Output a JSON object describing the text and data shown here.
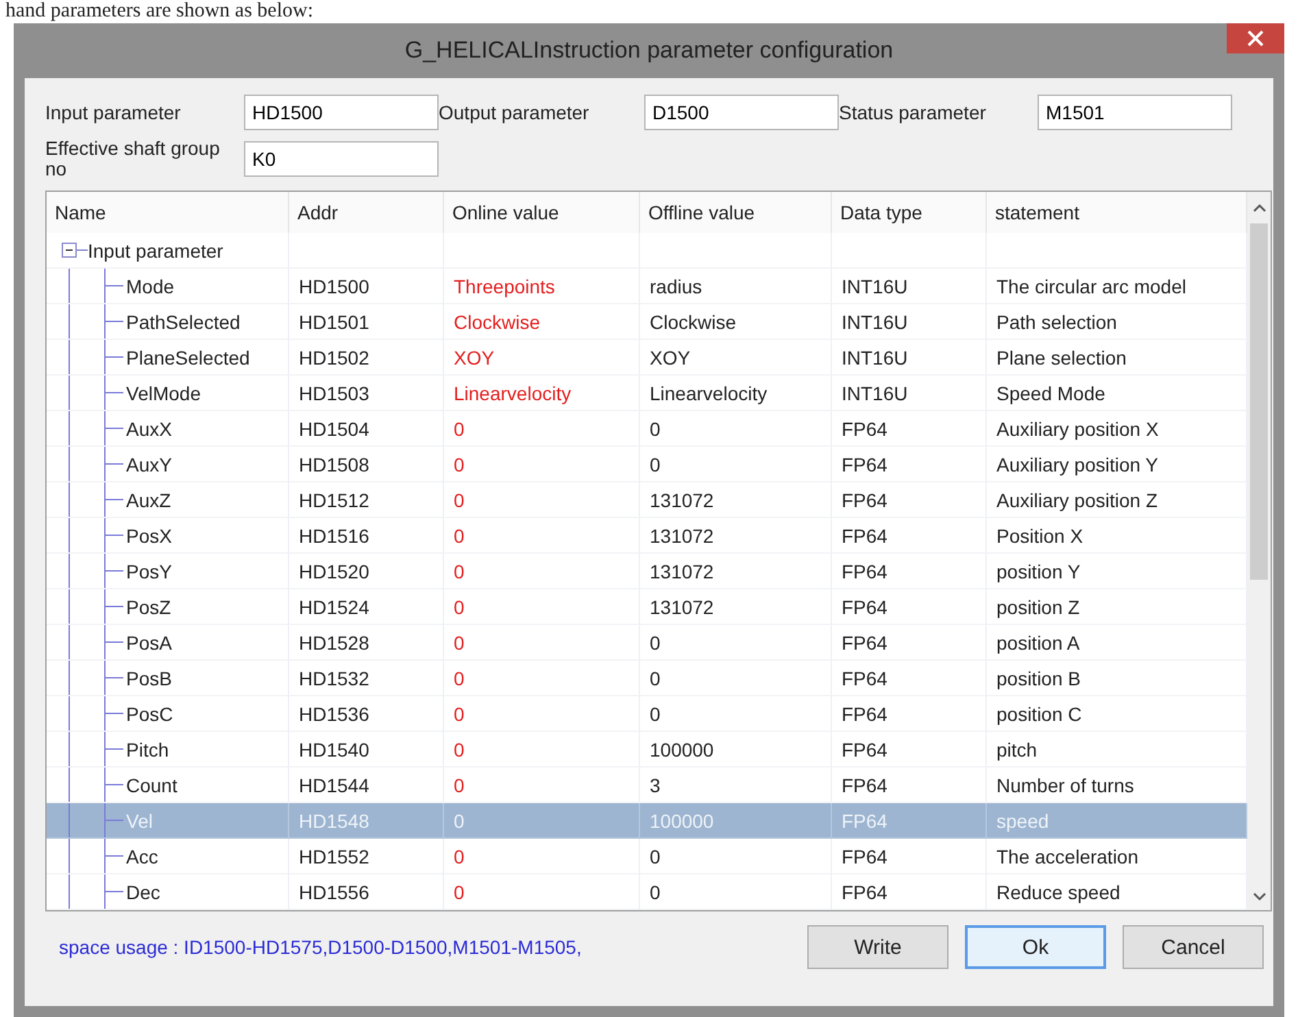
{
  "doc_caption": "hand parameters are shown as below:",
  "window": {
    "title": "G_HELICALInstruction parameter configuration"
  },
  "fields": [
    {
      "label": "Input parameter",
      "value": "HD1500"
    },
    {
      "label": "Output parameter",
      "value": "D1500"
    },
    {
      "label": "Status parameter",
      "value": "M1501"
    },
    {
      "label": "Effective shaft group no",
      "value": "K0"
    }
  ],
  "table": {
    "columns": [
      "Name",
      "Addr",
      "Online value",
      "Offline value",
      "Data type",
      "statement"
    ],
    "groups": [
      {
        "name": "Input parameter",
        "expanded": true,
        "children": [
          {
            "name": "Mode",
            "addr": "HD1500",
            "online": "Threepoints",
            "offline": "radius",
            "type": "INT16U",
            "statement": "The circular arc model",
            "selected": false
          },
          {
            "name": "PathSelected",
            "addr": "HD1501",
            "online": "Clockwise",
            "offline": "Clockwise",
            "type": "INT16U",
            "statement": "Path selection",
            "selected": false
          },
          {
            "name": "PlaneSelected",
            "addr": "HD1502",
            "online": "XOY",
            "offline": "XOY",
            "type": "INT16U",
            "statement": "Plane selection",
            "selected": false
          },
          {
            "name": "VelMode",
            "addr": "HD1503",
            "online": "Linearvelocity",
            "offline": "Linearvelocity",
            "type": "INT16U",
            "statement": "Speed Mode",
            "selected": false
          },
          {
            "name": "AuxX",
            "addr": "HD1504",
            "online": "0",
            "offline": "0",
            "type": "FP64",
            "statement": "Auxiliary position X",
            "selected": false
          },
          {
            "name": "AuxY",
            "addr": "HD1508",
            "online": "0",
            "offline": "0",
            "type": "FP64",
            "statement": "Auxiliary position Y",
            "selected": false
          },
          {
            "name": "AuxZ",
            "addr": "HD1512",
            "online": "0",
            "offline": "131072",
            "type": "FP64",
            "statement": "Auxiliary position Z",
            "selected": false
          },
          {
            "name": "PosX",
            "addr": "HD1516",
            "online": "0",
            "offline": "131072",
            "type": "FP64",
            "statement": "Position X",
            "selected": false
          },
          {
            "name": "PosY",
            "addr": "HD1520",
            "online": "0",
            "offline": "131072",
            "type": "FP64",
            "statement": "position Y",
            "selected": false
          },
          {
            "name": "PosZ",
            "addr": "HD1524",
            "online": "0",
            "offline": "131072",
            "type": "FP64",
            "statement": "position Z",
            "selected": false
          },
          {
            "name": "PosA",
            "addr": "HD1528",
            "online": "0",
            "offline": "0",
            "type": "FP64",
            "statement": "position A",
            "selected": false
          },
          {
            "name": "PosB",
            "addr": "HD1532",
            "online": "0",
            "offline": "0",
            "type": "FP64",
            "statement": "position B",
            "selected": false
          },
          {
            "name": "PosC",
            "addr": "HD1536",
            "online": "0",
            "offline": "0",
            "type": "FP64",
            "statement": "position C",
            "selected": false
          },
          {
            "name": "Pitch",
            "addr": "HD1540",
            "online": "0",
            "offline": "100000",
            "type": "FP64",
            "statement": "pitch",
            "selected": false
          },
          {
            "name": "Count",
            "addr": "HD1544",
            "online": "0",
            "offline": "3",
            "type": "FP64",
            "statement": "Number of turns",
            "selected": false
          },
          {
            "name": "Vel",
            "addr": "HD1548",
            "online": "0",
            "offline": "100000",
            "type": "FP64",
            "statement": "speed",
            "selected": true
          },
          {
            "name": "Acc",
            "addr": "HD1552",
            "online": "0",
            "offline": "0",
            "type": "FP64",
            "statement": "The acceleration",
            "selected": false
          },
          {
            "name": "Dec",
            "addr": "HD1556",
            "online": "0",
            "offline": "0",
            "type": "FP64",
            "statement": "Reduce speed",
            "selected": false
          }
        ]
      }
    ]
  },
  "status": "space usage : ID1500-HD1575,D1500-D1500,M1501-M1505,",
  "buttons": [
    {
      "label": "Write",
      "focused": false
    },
    {
      "label": "Ok",
      "focused": true
    },
    {
      "label": "Cancel",
      "focused": false
    }
  ]
}
